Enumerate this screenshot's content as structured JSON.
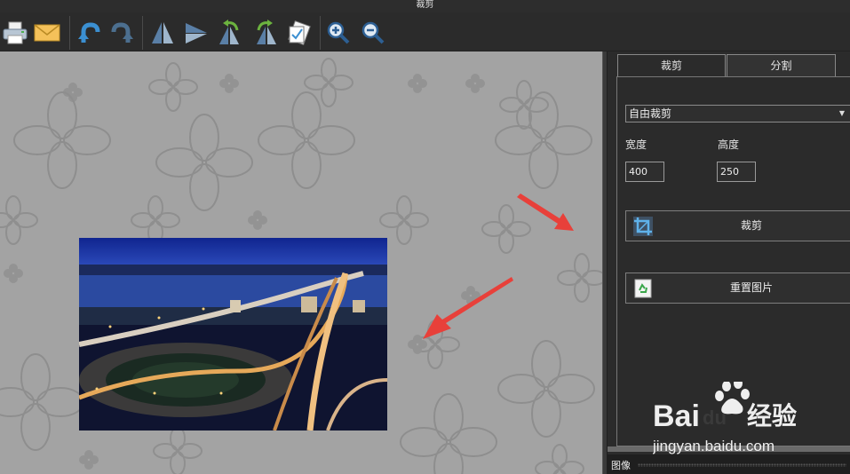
{
  "window": {
    "title": "裁剪"
  },
  "toolbar": {
    "buttons": [
      {
        "name": "print-icon"
      },
      {
        "name": "email-icon"
      },
      {
        "name": "undo-icon"
      },
      {
        "name": "redo-icon"
      },
      {
        "name": "flip-vertical-icon"
      },
      {
        "name": "flip-horizontal-icon"
      },
      {
        "name": "rotate-left-icon"
      },
      {
        "name": "rotate-right-icon"
      },
      {
        "name": "crop-tool-icon"
      },
      {
        "name": "zoom-in-icon"
      },
      {
        "name": "zoom-out-icon"
      }
    ]
  },
  "sidebar": {
    "tabs": [
      "裁剪",
      "分割"
    ],
    "mode_select": {
      "value": "自由裁剪"
    },
    "width_label": "宽度",
    "height_label": "高度",
    "width_value": "400",
    "height_value": "250",
    "crop_button": "裁剪",
    "reset_button": "重置图片",
    "bottom_pane_title": "图像"
  },
  "watermark": {
    "brand": "Baidu经验",
    "url": "jingyan.baidu.com"
  },
  "colors": {
    "canvas_bg": "#a3a3a3",
    "app_bg": "#2b2b2b",
    "arrow": "#e8403a",
    "accent": "#2a8fd6"
  }
}
